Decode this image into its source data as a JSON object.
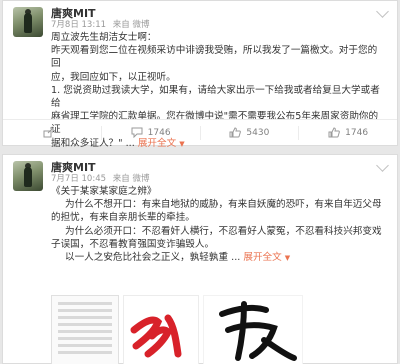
{
  "posts": [
    {
      "author": "唐爽MIT",
      "time": "7月8日 13:11",
      "source_prefix": "来自",
      "source": "微博",
      "lines": [
        "周立波先生胡洁女士啊：",
        "昨天观看到您二位在视频采访中诽谤我受贿，所以我发了一篇檄文。对于您的回",
        "应，我回应如下，以正视听。",
        "1. 您说资助过我读大学，如果有，请给大家出示一下给我或者给复旦大学或者给",
        "麻省理工学院的汇款单据。您在微博中说\"需不需要我公布5年来周家资助你的证",
        "据和众多证人？\" ..."
      ],
      "more": "展开全文",
      "actions": {
        "share": "",
        "comment": "1746",
        "like": "5430",
        "like2": "1746"
      }
    },
    {
      "author": "唐爽MIT",
      "time": "7月7日 10:45",
      "source_prefix": "来自",
      "source": "微博",
      "lines": [
        "《关于某家某家庭之辨》",
        "为什么不想开口：有来自地狱的威胁，有来自妖魔的恐吓，有来自年迈父母",
        "的担忧，有来自亲朋长辈的牵挂。",
        "为什么必须开口：不忍看奸人横行，不忍看好人蒙冤，不忍看科技兴邦变戏",
        "子误国，不忍看教育强国变诈骗毁人。",
        "以一人之安危比社会之正义，孰轻孰重 ..."
      ],
      "more": "展开全文"
    }
  ],
  "icons": {
    "share": "share-icon",
    "comment": "comment-icon",
    "like": "like-icon"
  },
  "colors": {
    "link": "#eb7350",
    "calligraphy_red": "#d8222a",
    "calligraphy_black": "#111111"
  }
}
